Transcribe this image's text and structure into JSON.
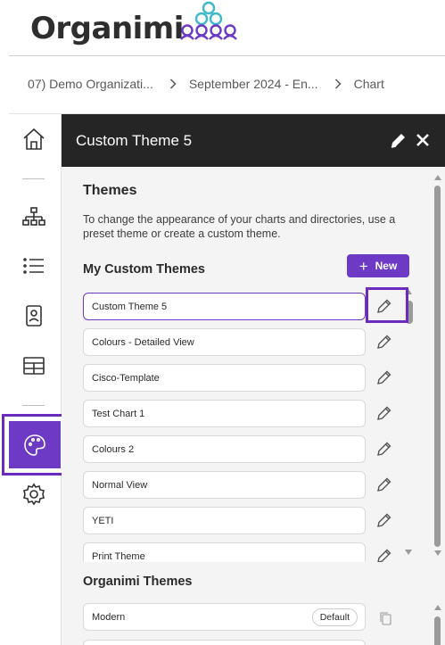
{
  "app": {
    "logo_text": "Organimi",
    "brand_color": "#6d3ac6",
    "logo_teal": "#3fb8c8"
  },
  "breadcrumb": {
    "items": [
      "07) Demo Organizati...",
      "September 2024 - En...",
      "Chart"
    ],
    "separator_icon": "chevron-right-icon"
  },
  "rail": {
    "items": [
      {
        "name": "home",
        "icon": "home-icon"
      },
      {
        "name": "org-chart",
        "icon": "org-chart-icon"
      },
      {
        "name": "list",
        "icon": "list-icon"
      },
      {
        "name": "directory",
        "icon": "person-card-icon"
      },
      {
        "name": "table",
        "icon": "table-icon"
      },
      {
        "name": "themes",
        "icon": "palette-icon",
        "active": true
      },
      {
        "name": "settings",
        "icon": "gear-icon"
      }
    ]
  },
  "panel": {
    "title": "Custom Theme 5",
    "edit_icon": "pencil-icon",
    "close_icon": "close-icon",
    "section_title": "Themes",
    "description": "To change the appearance of your charts and directories, use a preset theme or create a custom theme.",
    "custom_title": "My Custom Themes",
    "new_button": "New",
    "custom_themes": [
      {
        "label": "Custom Theme 5",
        "selected": true
      },
      {
        "label": "Colours - Detailed View"
      },
      {
        "label": "Cisco-Template"
      },
      {
        "label": "Test Chart 1"
      },
      {
        "label": "Colours 2"
      },
      {
        "label": "Normal View"
      },
      {
        "label": "YETI"
      },
      {
        "label": "Print Theme"
      }
    ],
    "organimi_title": "Organimi Themes",
    "organimi_themes": [
      {
        "label": "Modern",
        "badge": "Default",
        "icon": "copy-icon"
      }
    ]
  }
}
